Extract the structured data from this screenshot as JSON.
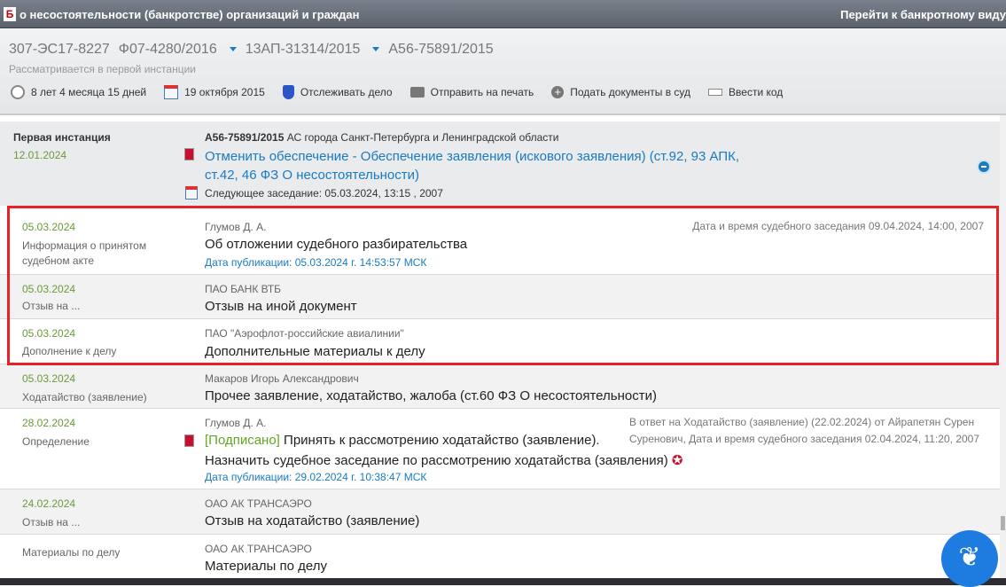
{
  "titlebar": {
    "logo": "Б",
    "title": "о несостоятельности (банкротстве) организаций и граждан",
    "right_link": "Перейти к банкротному виду"
  },
  "header": {
    "cases": [
      "307-ЭС17-8227",
      "Ф07-4280/2016",
      "13АП-31314/2015",
      "А56-75891/2015"
    ],
    "status": "Рассматривается в первой инстанции",
    "toolbar": [
      {
        "icon": "clock-icon",
        "label": "8 лет 4 месяца 15 дней"
      },
      {
        "icon": "calendar-icon",
        "label": "19 октября 2015"
      },
      {
        "icon": "shield-icon",
        "label": "Отслеживать дело"
      },
      {
        "icon": "printer-icon",
        "label": "Отправить на печать"
      },
      {
        "icon": "plus-circle-icon",
        "label": "Подать документы в суд"
      },
      {
        "icon": "code-icon",
        "label": "Ввести код"
      }
    ]
  },
  "instance": {
    "title": "Первая инстанция",
    "date": "12.01.2024",
    "case_no": "А56-75891/2015",
    "court": "АС города Санкт-Петербурга и Ленинградской области",
    "link_line1": "Отменить обеспечение - Обеспечение заявления (искового заявления) (ст.92, 93 АПК,",
    "link_line2": "ст.42, 46 ФЗ О несостоятельности)",
    "next_session": "Следующее заседание: 05.03.2024, 13:15 , 2007"
  },
  "rows": [
    {
      "date": "05.03.2024",
      "type": "Информация о принятом судебном акте",
      "who": "Глумов Д. А.",
      "main": "Об отложении судебного разбирательства",
      "pub": "Дата публикации: 05.03.2024 г. 14:53:57 МСК",
      "note": "Дата и время судебного заседания 09.04.2024, 14:00, 2007"
    },
    {
      "date": "05.03.2024",
      "type": "Отзыв на ...",
      "who": "ПАО БАНК ВТБ",
      "main": "Отзыв на иной документ"
    },
    {
      "date": "05.03.2024",
      "type": "Дополнение к делу",
      "who": "ПАО \"Аэрофлот-российские авиалинии\"",
      "main": "Дополнительные материалы к делу"
    },
    {
      "date": "05.03.2024",
      "type": "Ходатайство (заявление)",
      "who": "Макаров Игорь Александрович",
      "main": "Прочее заявление, ходатайство, жалоба (ст.60 ФЗ О несостоятельности)"
    },
    {
      "date": "28.02.2024",
      "type": "Определение",
      "who": "Глумов Д. А.",
      "signed": "[Подписано]",
      "main": "Принять к рассмотрению ходатайство (заявление).",
      "main2": "Назначить судебное заседание по рассмотрению ходатайства (заявления)",
      "pub": "Дата публикации: 29.02.2024 г. 10:38:47 МСК",
      "note1": "В ответ на Ходатайство (заявление) (22.02.2024) от Айрапетян Сурен",
      "note2": "Суренович, Дата и время судебного заседания 02.04.2024, 11:20, 2007"
    },
    {
      "date": "24.02.2024",
      "type": "Отзыв на ...",
      "who": "ОАО АК ТРАНСАЭРО",
      "main": "Отзыв на ходатайство (заявление)"
    },
    {
      "type": "Материалы по делу",
      "who": "ОАО АК ТРАНСАЭРО",
      "main": "Материалы по делу"
    }
  ]
}
